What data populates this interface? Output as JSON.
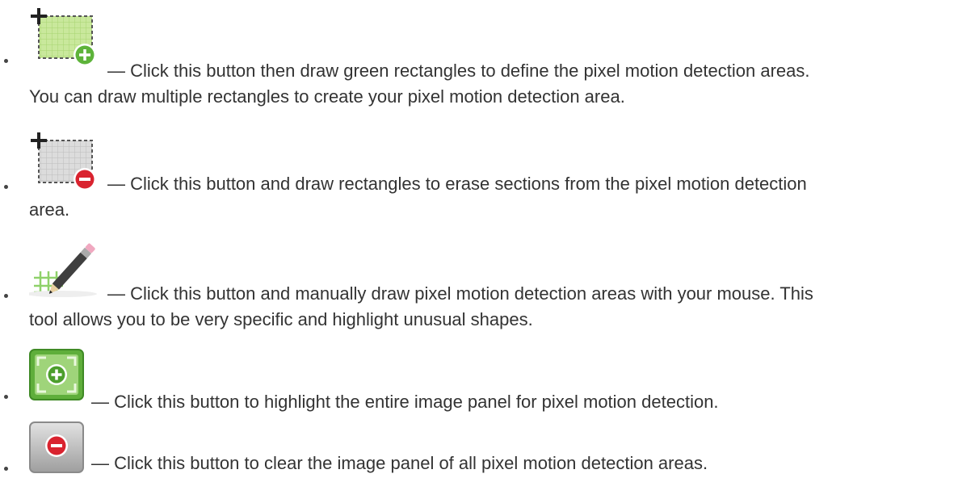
{
  "items": [
    {
      "icon": "add-rectangle-area-icon",
      "line1": "— Click this button then draw green rectangles to define the pixel motion detection areas.",
      "line2": "You can draw multiple rectangles to create your pixel motion detection area."
    },
    {
      "icon": "erase-rectangle-area-icon",
      "line1": "— Click this button and draw rectangles to erase sections from the pixel motion detection",
      "line2": "area."
    },
    {
      "icon": "pencil-draw-area-icon",
      "line1": "— Click this button and manually draw pixel motion detection areas with your mouse. This",
      "line2": "tool allows you to be very specific and highlight unusual shapes."
    },
    {
      "icon": "select-entire-panel-icon",
      "line1": "— Click this button to highlight the entire image panel for pixel motion detection."
    },
    {
      "icon": "clear-panel-icon",
      "line1": "— Click this button to clear the image panel of all pixel motion detection areas."
    }
  ],
  "colors": {
    "text": "#333333",
    "green": "#6cc04a",
    "red": "#d9232f",
    "grid_green": "#b9e08a",
    "grid_grey": "#d6d6d6"
  }
}
